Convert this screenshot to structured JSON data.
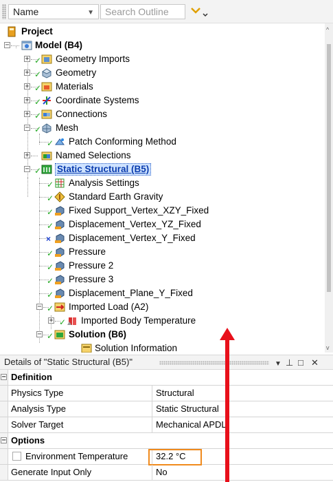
{
  "toolbar": {
    "filter_label": "Name",
    "search_placeholder": "Search Outline"
  },
  "tree": {
    "project": "Project",
    "model": "Model (B4)",
    "geometry_imports": "Geometry Imports",
    "geometry": "Geometry",
    "materials": "Materials",
    "coordinate_systems": "Coordinate Systems",
    "connections": "Connections",
    "mesh": "Mesh",
    "patch_conforming": "Patch Conforming Method",
    "named_selections": "Named Selections",
    "static_structural": "Static Structural (B5)",
    "analysis_settings": "Analysis Settings",
    "standard_earth_gravity": "Standard Earth Gravity",
    "fixed_support": "Fixed Support_Vertex_XZY_Fixed",
    "displacement_yz": "Displacement_Vertex_YZ_Fixed",
    "displacement_y": "Displacement_Vertex_Y_Fixed",
    "pressure": "Pressure",
    "pressure2": "Pressure 2",
    "pressure3": "Pressure 3",
    "displacement_plane": "Displacement_Plane_Y_Fixed",
    "imported_load": "Imported Load (A2)",
    "imported_body_temp": "Imported Body Temperature",
    "solution": "Solution (B6)",
    "solution_information": "Solution Information"
  },
  "details": {
    "title": "Details of \"Static Structural (B5)\"",
    "sections": {
      "definition": "Definition",
      "options": "Options"
    },
    "rows": {
      "physics_type": {
        "key": "Physics Type",
        "value": "Structural"
      },
      "analysis_type": {
        "key": "Analysis Type",
        "value": "Static Structural"
      },
      "solver_target": {
        "key": "Solver Target",
        "value": "Mechanical APDL"
      },
      "env_temp": {
        "key": "Environment Temperature",
        "value": "32.2 °C"
      },
      "gen_input": {
        "key": "Generate Input Only",
        "value": "No"
      }
    }
  },
  "colors": {
    "check": "#22a822",
    "highlight": "#f08a1c",
    "arrow": "#e8101b",
    "selection": "#cfe3ff"
  }
}
